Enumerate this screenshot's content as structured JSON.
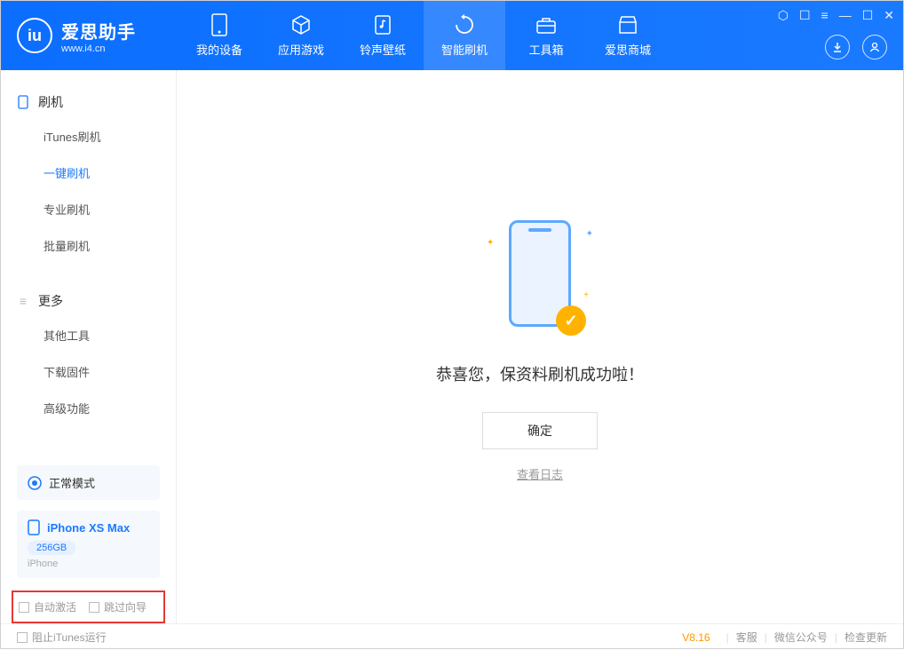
{
  "app": {
    "name": "爱思助手",
    "url": "www.i4.cn",
    "logo_letter": "iu"
  },
  "tabs": [
    {
      "label": "我的设备",
      "icon": "device"
    },
    {
      "label": "应用游戏",
      "icon": "cube"
    },
    {
      "label": "铃声壁纸",
      "icon": "music"
    },
    {
      "label": "智能刷机",
      "icon": "refresh"
    },
    {
      "label": "工具箱",
      "icon": "toolbox"
    },
    {
      "label": "爱思商城",
      "icon": "store"
    }
  ],
  "sidebar": {
    "section1_title": "刷机",
    "items1": [
      "iTunes刷机",
      "一键刷机",
      "专业刷机",
      "批量刷机"
    ],
    "section2_title": "更多",
    "items2": [
      "其他工具",
      "下载固件",
      "高级功能"
    ]
  },
  "status": {
    "label": "正常模式"
  },
  "device": {
    "name": "iPhone XS Max",
    "storage": "256GB",
    "type": "iPhone"
  },
  "options": {
    "auto_activate": "自动激活",
    "skip_guide": "跳过向导"
  },
  "main": {
    "success_message": "恭喜您，保资料刷机成功啦！",
    "ok_button": "确定",
    "view_log": "查看日志"
  },
  "footer": {
    "block_itunes": "阻止iTunes运行",
    "version": "V8.16",
    "links": [
      "客服",
      "微信公众号",
      "检查更新"
    ]
  }
}
